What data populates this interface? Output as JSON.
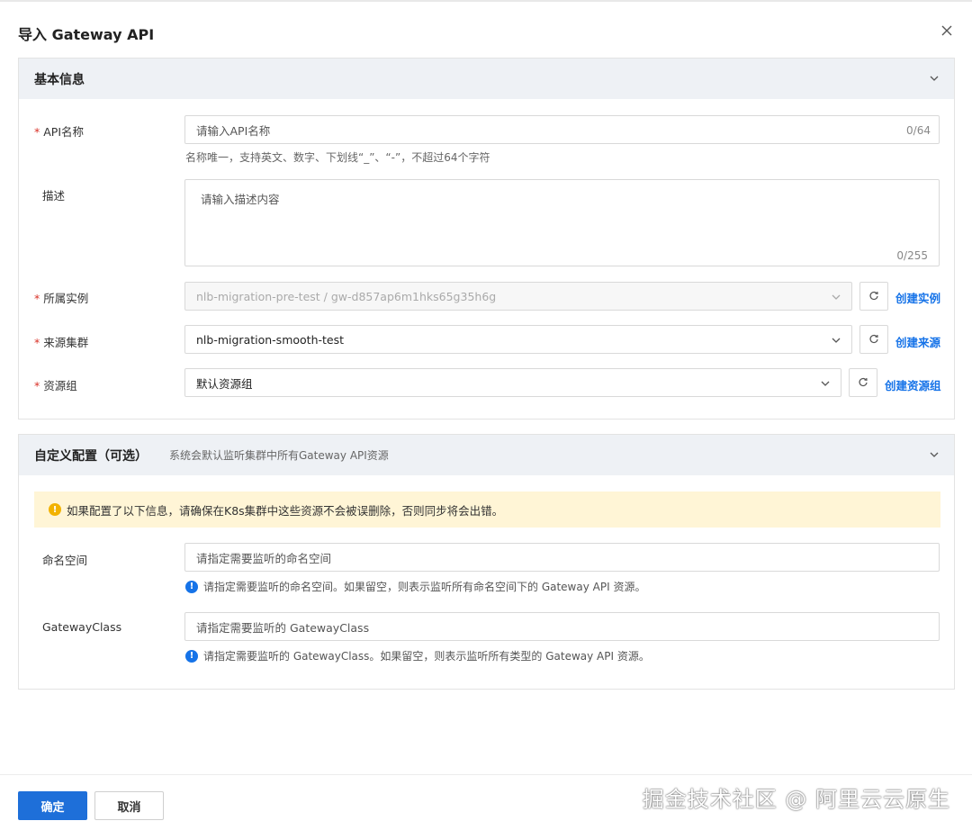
{
  "dialog": {
    "title": "导入 Gateway API"
  },
  "basic": {
    "title": "基本信息",
    "api_name": {
      "label": "API名称",
      "placeholder": "请输入API名称",
      "counter": "0/64",
      "hint": "名称唯一，支持英文、数字、下划线“_”、“-”，不超过64个字符"
    },
    "desc": {
      "label": "描述",
      "placeholder": "请输入描述内容",
      "counter": "0/255"
    },
    "instance": {
      "label": "所属实例",
      "value": "nlb-migration-pre-test / gw-d857ap6m1hks65g35h6g",
      "link": "创建实例"
    },
    "source": {
      "label": "来源集群",
      "value": "nlb-migration-smooth-test",
      "link": "创建来源"
    },
    "resource_group": {
      "label": "资源组",
      "value": "默认资源组",
      "link": "创建资源组"
    }
  },
  "custom": {
    "title": "自定义配置（可选）",
    "subtitle": "系统会默认监听集群中所有Gateway API资源",
    "warning": "如果配置了以下信息，请确保在K8s集群中这些资源不会被误删除，否则同步将会出错。",
    "namespace": {
      "label": "命名空间",
      "placeholder": "请指定需要监听的命名空间",
      "hint": "请指定需要监听的命名空间。如果留空，则表示监听所有命名空间下的 Gateway API 资源。"
    },
    "gateway_class": {
      "label": "GatewayClass",
      "placeholder": "请指定需要监听的 GatewayClass",
      "hint": "请指定需要监听的 GatewayClass。如果留空，则表示监听所有类型的 Gateway API 资源。"
    }
  },
  "footer": {
    "confirm": "确定",
    "cancel": "取消"
  },
  "watermark": "掘金技术社区 @ 阿里云云原生",
  "colors": {
    "primary": "#1e6fd9",
    "link": "#1673e8",
    "required": "#d93026",
    "warning_bg": "#fff5d6",
    "warning_icon": "#f2b200",
    "header_bg": "#eef1f5"
  }
}
